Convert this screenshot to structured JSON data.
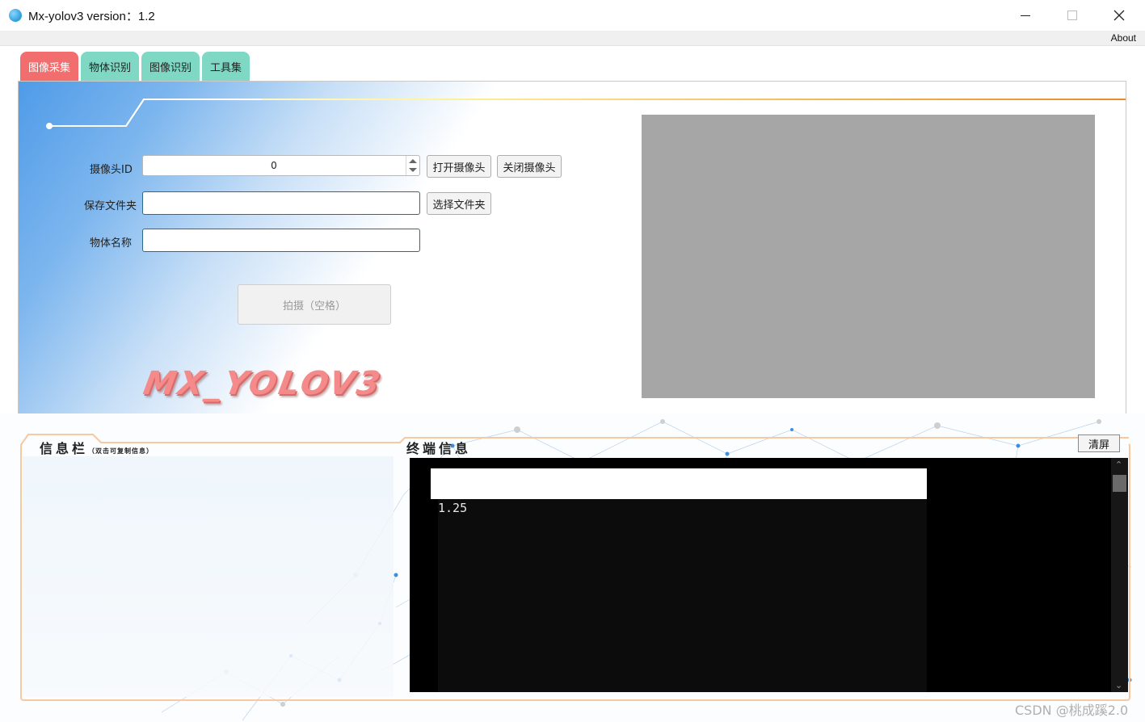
{
  "window": {
    "title": "Mx-yolov3 version：1.2",
    "icon": "app-globe-icon",
    "menu_about": "About"
  },
  "tabs": [
    {
      "label": "图像采集",
      "active": true
    },
    {
      "label": "物体识别",
      "active": false
    },
    {
      "label": "图像识别",
      "active": false
    },
    {
      "label": "工具集",
      "active": false
    }
  ],
  "capture": {
    "camera_id_label": "摄像头ID",
    "camera_id_value": "0",
    "open_camera": "打开摄像头",
    "close_camera": "关闭摄像头",
    "save_folder_label": "保存文件夹",
    "save_folder_value": "",
    "choose_folder": "选择文件夹",
    "object_name_label": "物体名称",
    "object_name_value": "",
    "shoot_button": "拍摄（空格）",
    "brand": "MX_YOLOV3"
  },
  "info_panel": {
    "title": "信息栏",
    "subtitle": "（双击可复制信息）"
  },
  "terminal_panel": {
    "title": "终端信息",
    "clear_button": "清屏",
    "output": "1.25"
  },
  "watermark": "CSDN @桃成蹊2.0",
  "colors": {
    "active_tab": "#f26e6e",
    "inactive_tab": "#7fd8c3",
    "preview": "#a6a6a6",
    "frame": "#f8c8a0"
  }
}
